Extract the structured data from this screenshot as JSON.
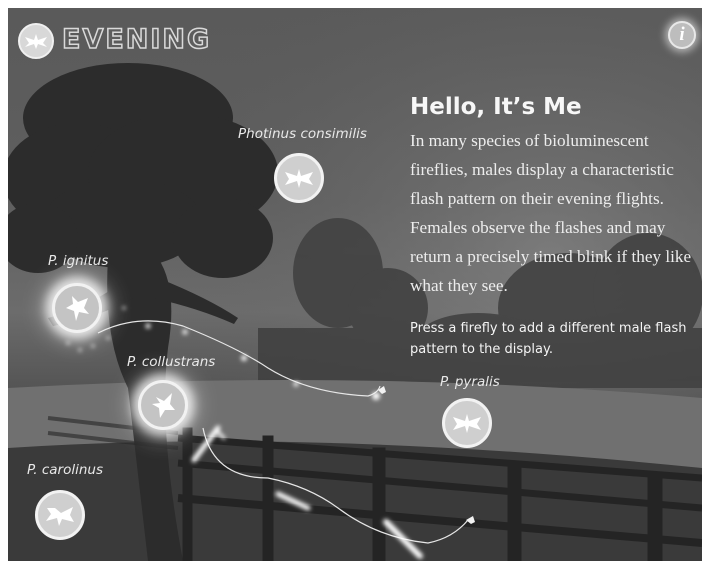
{
  "header": {
    "title": "EVENING",
    "menu_icon": "firefly-icon",
    "info_icon": "info-icon",
    "info_glyph": "i"
  },
  "content": {
    "heading": "Hello, It’s Me",
    "body": "In many species of bioluminescent fireflies, males display a characteristic flash pattern on their evening flights. Females observe the flashes and may return a precisely timed blink if they like what they see.",
    "prompt": "Press a firefly to add a different male flash pattern to the display."
  },
  "fireflies": [
    {
      "label": "Photinus consimilis",
      "icon": "firefly-icon",
      "active": false
    },
    {
      "label": "P. ignitus",
      "icon": "firefly-icon",
      "active": true
    },
    {
      "label": "P. collustrans",
      "icon": "firefly-icon",
      "active": true
    },
    {
      "label": "P. pyralis",
      "icon": "firefly-icon",
      "active": false
    },
    {
      "label": "P. carolinus",
      "icon": "firefly-icon",
      "active": false
    }
  ],
  "colors": {
    "sky": "#5f5f5f",
    "ground": "#2e2e2e",
    "text": "#f4f4f4",
    "glow": "#ffffff"
  }
}
